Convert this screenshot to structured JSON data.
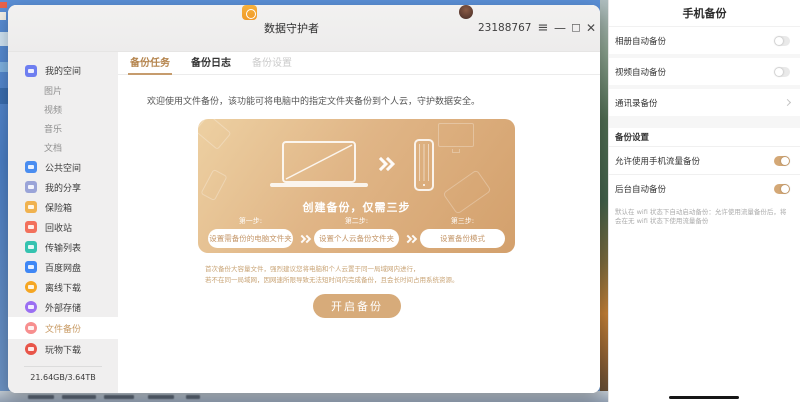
{
  "window": {
    "title": "数据守护者",
    "user_id": "23188767",
    "controls": {
      "menu_icon": "≡",
      "minimize_icon": "—",
      "maximize_icon": "□",
      "close_icon": "✕"
    }
  },
  "sidebar": {
    "items": [
      {
        "label": "我的空间",
        "icon": "my-space-icon",
        "color": "#6e7ef0",
        "shape": "square",
        "type": "root"
      },
      {
        "label": "图片",
        "type": "sub"
      },
      {
        "label": "视频",
        "type": "sub"
      },
      {
        "label": "音乐",
        "type": "sub"
      },
      {
        "label": "文档",
        "type": "sub"
      },
      {
        "label": "公共空间",
        "icon": "public-space-icon",
        "color": "#4a8df0",
        "shape": "square",
        "type": "root"
      },
      {
        "label": "我的分享",
        "icon": "my-share-icon",
        "color": "#9aa4d8",
        "shape": "square",
        "type": "root"
      },
      {
        "label": "保险箱",
        "icon": "safe-box-icon",
        "color": "#f0b24f",
        "shape": "square",
        "type": "root"
      },
      {
        "label": "回收站",
        "icon": "recycle-bin-icon",
        "color": "#f2705c",
        "shape": "square",
        "type": "root"
      },
      {
        "label": "传输列表",
        "icon": "transfer-list-icon",
        "color": "#35c3b0",
        "shape": "square",
        "type": "root"
      },
      {
        "label": "百度网盘",
        "icon": "baidu-netdisk-icon",
        "color": "#3f87f5",
        "shape": "square",
        "type": "root"
      },
      {
        "label": "离线下载",
        "icon": "offline-download-icon",
        "color": "#f5a623",
        "shape": "circle",
        "type": "root"
      },
      {
        "label": "外部存储",
        "icon": "external-storage-icon",
        "color": "#9b6ff2",
        "shape": "circle",
        "type": "root"
      },
      {
        "label": "文件备份",
        "icon": "file-backup-icon",
        "color": "#f78f8f",
        "shape": "circle",
        "type": "root",
        "selected": true
      },
      {
        "label": "玩物下载",
        "icon": "wanwu-download-icon",
        "color": "#e85549",
        "shape": "circle",
        "type": "root"
      }
    ],
    "storage": "21.64GB/3.64TB"
  },
  "tabs": [
    {
      "label": "备份任务",
      "state": "active"
    },
    {
      "label": "备份日志",
      "state": "normal"
    },
    {
      "label": "备份设置",
      "state": "disabled"
    }
  ],
  "main": {
    "welcome": "欢迎使用文件备份，该功能可将电脑中的指定文件夹备份到个人云，守护数据安全。",
    "card": {
      "headline": "创建备份，仅需三步",
      "steps": [
        {
          "label": "第一步:",
          "button": "设置需备份的电脑文件夹"
        },
        {
          "label": "第二步:",
          "button": "设置个人云备份文件夹"
        },
        {
          "label": "第三步:",
          "button": "设置备份模式"
        }
      ]
    },
    "note_line1": "首次备份大容量文件，强烈建议您将电脑和个人云置于同一局域网内进行，",
    "note_line2": "若不在同一局域网，因网速所限导致无法短时间内完成备份，且会长时间占用系统资源。",
    "start_button": "开启备份"
  },
  "phone": {
    "title": "手机备份",
    "rows": [
      {
        "label": "相册自动备份",
        "control": "toggle",
        "on": false
      },
      {
        "label": "视频自动备份",
        "control": "toggle",
        "on": false
      },
      {
        "label": "通讯录备份",
        "control": "chevron"
      }
    ],
    "section_title": "备份设置",
    "settings": [
      {
        "label": "允许使用手机流量备份",
        "on": true
      },
      {
        "label": "后台自动备份",
        "on": true
      }
    ],
    "note": "默认在 wifi 状态下自动启动备份：允许使用流量备份后，将会在无 wifi 状态下使用流量备份"
  },
  "colors": {
    "accent_gold": "#c69c6d",
    "toggle_on": "#d4a876",
    "card_gradient_start": "#edd0a2",
    "card_gradient_end": "#d3a06c",
    "start_button_bg": "#d7ab7a",
    "sidebar_bg": "#f0efef"
  }
}
